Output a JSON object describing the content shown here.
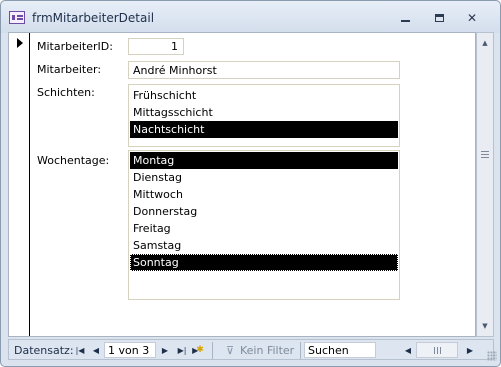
{
  "window": {
    "title": "frmMitarbeiterDetail",
    "minimize_icon": "minimize-icon",
    "maximize_icon": "maximize-icon",
    "close_icon": "close-icon"
  },
  "form": {
    "id_label": "MitarbeiterID:",
    "id_value": "1",
    "employee_label": "Mitarbeiter:",
    "employee_value": "André Minhorst",
    "shifts_label": "Schichten:",
    "shifts": [
      {
        "label": "Frühschicht",
        "selected": false
      },
      {
        "label": "Mittagsschicht",
        "selected": false
      },
      {
        "label": "Nachtschicht",
        "selected": true
      }
    ],
    "weekdays_label": "Wochentage:",
    "weekdays": [
      {
        "label": "Montag",
        "selected": true
      },
      {
        "label": "Dienstag",
        "selected": false
      },
      {
        "label": "Mittwoch",
        "selected": false
      },
      {
        "label": "Donnerstag",
        "selected": false
      },
      {
        "label": "Freitag",
        "selected": false
      },
      {
        "label": "Samstag",
        "selected": false
      },
      {
        "label": "Sonntag",
        "selected": true
      }
    ]
  },
  "navigation": {
    "label": "Datensatz:",
    "position": "1 von 3",
    "filter_label": "Kein Filter",
    "search_value": "Suchen"
  }
}
